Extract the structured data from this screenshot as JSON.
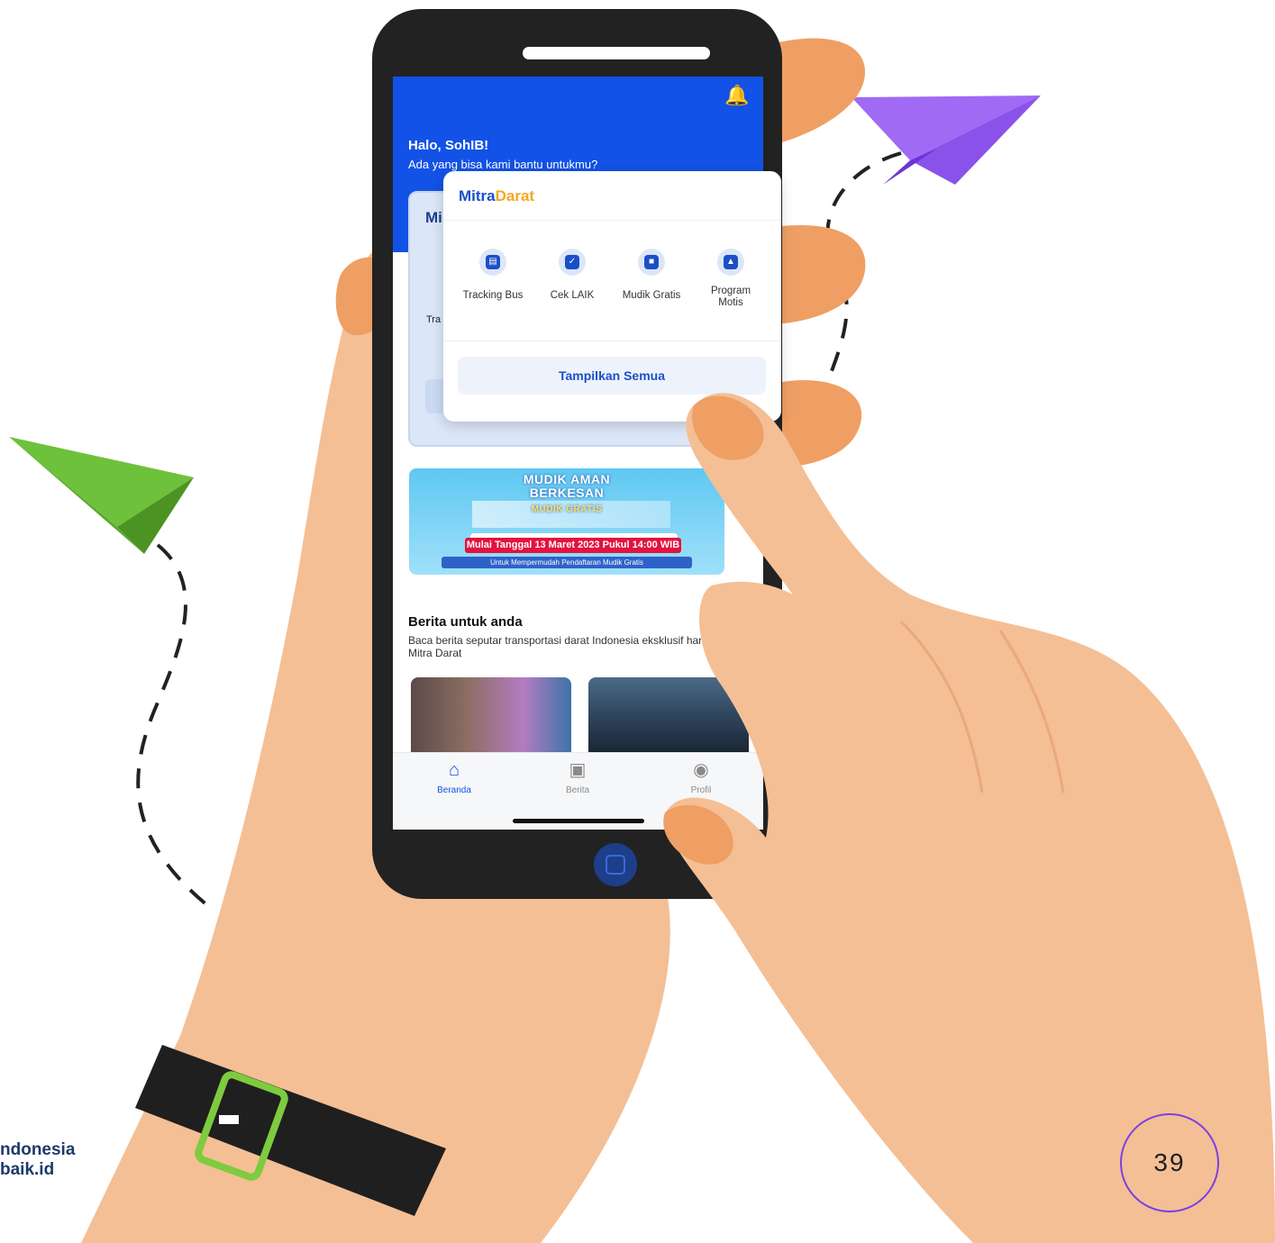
{
  "status": {
    "notification_icon": "bell-icon"
  },
  "greeting": {
    "title": "Halo, SohIB!",
    "subtitle": "Ada yang bisa kami bantu untukmu?"
  },
  "background_card": {
    "title": "Mi",
    "text": "Tra"
  },
  "popup": {
    "logo": {
      "part1": "Mitra",
      "part2": "Darat"
    },
    "menu": [
      {
        "label": "Tracking Bus",
        "icon": "bus-icon"
      },
      {
        "label": "Cek LAIK",
        "icon": "shield-check-icon"
      },
      {
        "label": "Mudik Gratis",
        "icon": "car-icon"
      },
      {
        "label": "Program\nMotis",
        "icon": "motorbike-icon"
      }
    ],
    "show_all": "Tampilkan Semua"
  },
  "banner": {
    "title1": "MUDIK AMAN",
    "title2": "BERKESAN",
    "title3": "MUDIK GRATIS",
    "date": "Mulai Tanggal 13 Maret 2023 Pukul 14:00 WIB",
    "note": "Untuk Mempermudah Pendaftaran Mudik Gratis"
  },
  "news": {
    "title": "Berita untuk anda",
    "subtitle": "Baca berita seputar transportasi darat Indonesia eksklusif hanya di Mitra Darat"
  },
  "tabs": [
    {
      "label": "Beranda",
      "icon": "home-icon",
      "active": true
    },
    {
      "label": "Berita",
      "icon": "book-icon",
      "active": false
    },
    {
      "label": "Profil",
      "icon": "user-icon",
      "active": false
    }
  ],
  "footer": {
    "brand_line1": "ndonesia",
    "brand_line2": "baik.id",
    "page_number": "39"
  },
  "colors": {
    "primary": "#1252e6",
    "accent": "#f5a623",
    "skin": "#f4bf95",
    "skin_dark": "#ef9f63"
  }
}
